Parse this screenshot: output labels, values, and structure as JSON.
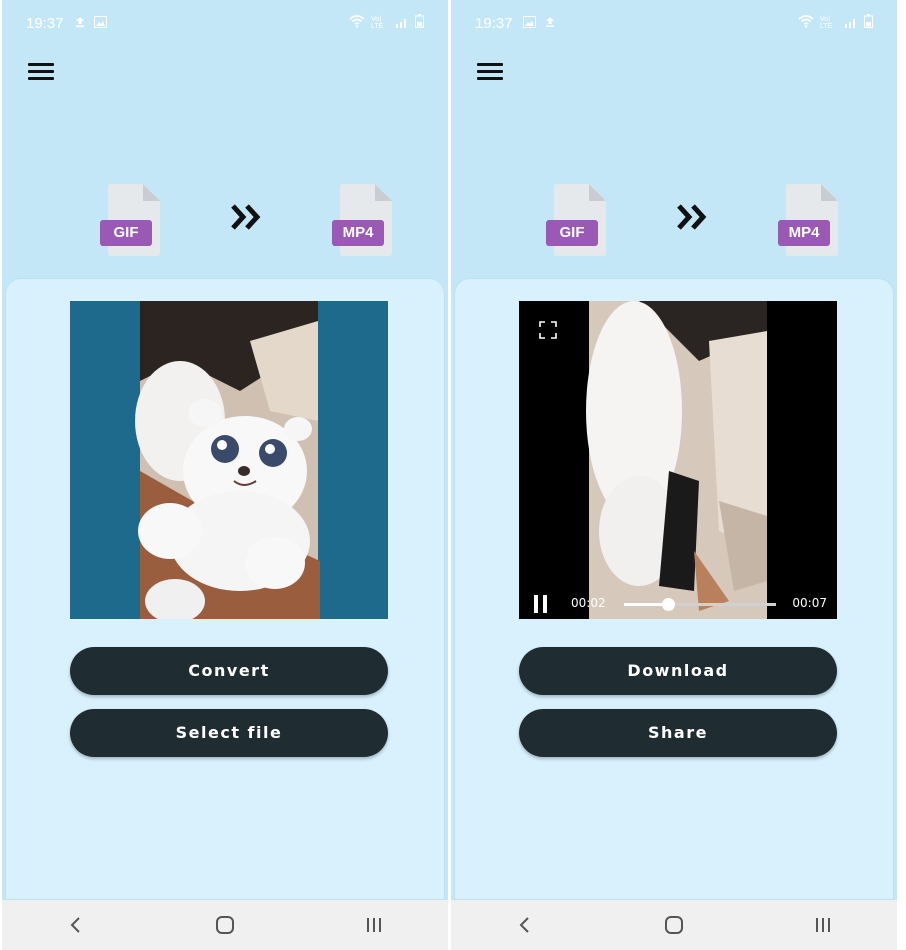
{
  "status_bar": {
    "time": "19:37",
    "network_label": "Vo) LTE"
  },
  "left_screen": {
    "from_format": "GIF",
    "to_format": "MP4",
    "buttons": {
      "convert": "Convert",
      "select_file": "Select file"
    }
  },
  "right_screen": {
    "from_format": "GIF",
    "to_format": "MP4",
    "player": {
      "current_time": "00:02",
      "duration": "00:07",
      "progress": 0.29
    },
    "buttons": {
      "download": "Download",
      "share": "Share"
    }
  },
  "colors": {
    "background": "#c4e7f8",
    "card": "#d9f0fd",
    "button": "#1f2d33",
    "badge": "#9b59b6",
    "preview_bg": "#1e6a8c"
  }
}
